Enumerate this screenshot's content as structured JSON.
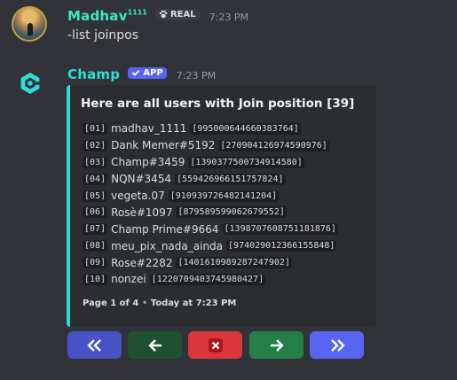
{
  "message1": {
    "author": "Madhav",
    "author_sup": "1111",
    "tag": "REAL",
    "time": "7:23 PM",
    "text": "-list joinpos",
    "name_color": "#3ee8c5"
  },
  "message2": {
    "author": "Champ",
    "tag": "APP",
    "time": "7:23 PM",
    "name_color": "#2ddcd6",
    "embed": {
      "accent": "#2ddcd6",
      "title": "Here are all users with Join position [39]",
      "rows": [
        {
          "pos": "[01]",
          "user": "madhav_1111",
          "id": "[995000644660383764]"
        },
        {
          "pos": "[02]",
          "user": "Dank Memer#5192",
          "id": "[270904126974590976]"
        },
        {
          "pos": "[03]",
          "user": "Champ#3459",
          "id": "[1390377500734914580]"
        },
        {
          "pos": "[04]",
          "user": "NQN#3454",
          "id": "[559426966151757824]"
        },
        {
          "pos": "[05]",
          "user": "vegeta.07",
          "id": "[910939726482141204]"
        },
        {
          "pos": "[06]",
          "user": "Rosè#1097",
          "id": "[879589599062679552]"
        },
        {
          "pos": "[07]",
          "user": "Champ Prime#9664",
          "id": "[1398707608751181876]"
        },
        {
          "pos": "[08]",
          "user": "meu_pix_nada_ainda",
          "id": "[974029012366155848]"
        },
        {
          "pos": "[09]",
          "user": "Rose#2282",
          "id": "[1401610989287247902]"
        },
        {
          "pos": "[10]",
          "user": "nonzei",
          "id": "[1220709403745980427]"
        }
      ],
      "footer_page": "Page 1 of 4",
      "footer_sep": "•",
      "footer_time": "Today at 7:23 PM"
    }
  },
  "buttons": [
    {
      "name": "first-page-button",
      "icon": "double-chevron-left-icon",
      "color": "#4752c4"
    },
    {
      "name": "previous-page-button",
      "icon": "arrow-left-icon",
      "color": "#1f5131"
    },
    {
      "name": "stop-button",
      "icon": "close-icon",
      "color": "#da373c"
    },
    {
      "name": "next-page-button",
      "icon": "arrow-right-icon",
      "color": "#248046"
    },
    {
      "name": "last-page-button",
      "icon": "double-chevron-right-icon",
      "color": "#5865f2"
    }
  ]
}
